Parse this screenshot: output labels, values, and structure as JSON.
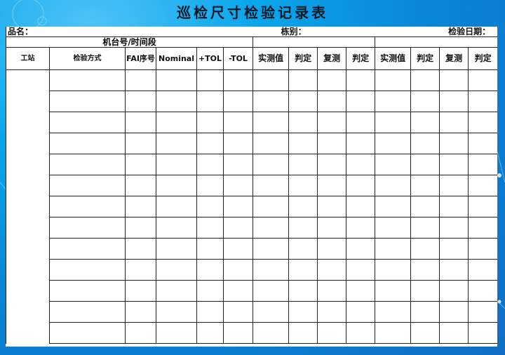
{
  "title": "巡检尺寸检验记录表",
  "info": {
    "product_label": "品名：",
    "building_label": "栋别：",
    "date_label": "检验日期："
  },
  "machine_period_label": "机台号/时间段",
  "columns": {
    "station": "工站",
    "method": "检验方式",
    "fai": "FAI序号",
    "nominal": "Nominal",
    "ptol": "+TOL",
    "ntol": "-TOL",
    "group1": [
      "实测值",
      "判定",
      "复测",
      "判定"
    ],
    "group2": [
      "实测值",
      "判定",
      "复测",
      "判定"
    ]
  },
  "colors": {
    "accent": "#0a8fe0",
    "border": "#222222"
  },
  "row_count": 13
}
